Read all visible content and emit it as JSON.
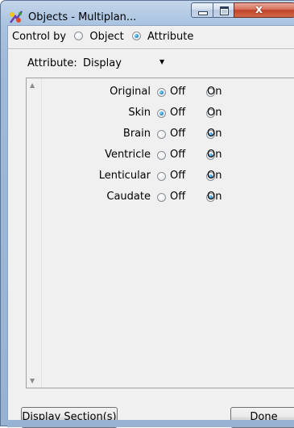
{
  "window": {
    "title": "Objects - Multiplan...",
    "close_glyph": "x",
    "icon": "app-icon"
  },
  "control": {
    "label": "Control by",
    "options": [
      {
        "label": "Object",
        "selected": false
      },
      {
        "label": "Attribute",
        "selected": true
      }
    ]
  },
  "attribute_selector": {
    "label": "Attribute:",
    "value": "Display",
    "caret": "▼"
  },
  "scroll": {
    "up": "▲",
    "down": "▼"
  },
  "attributes": [
    {
      "name": "Original",
      "off_label": "Off",
      "on_label": "On",
      "state": "off"
    },
    {
      "name": "Skin",
      "off_label": "Off",
      "on_label": "On",
      "state": "off"
    },
    {
      "name": "Brain",
      "off_label": "Off",
      "on_label": "On",
      "state": "on"
    },
    {
      "name": "Ventricle",
      "off_label": "Off",
      "on_label": "On",
      "state": "on"
    },
    {
      "name": "Lenticular",
      "off_label": "Off",
      "on_label": "On",
      "state": "on"
    },
    {
      "name": "Caudate",
      "off_label": "Off",
      "on_label": "On",
      "state": "on"
    }
  ],
  "buttons": {
    "display_section": "Display Section(s)",
    "done": "Done"
  }
}
